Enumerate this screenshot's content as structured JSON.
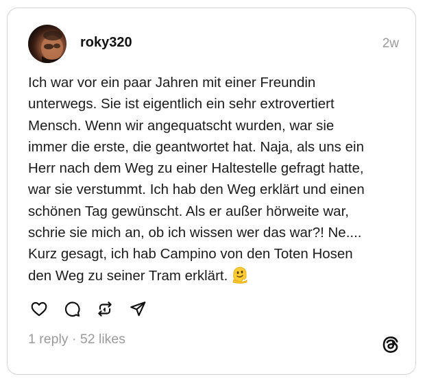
{
  "post": {
    "username": "roky320",
    "time": "2w",
    "text_lines": [
      "Ich war vor ein paar Jahren mit einer Freundin",
      "unterwegs. Sie ist eigentlich ein sehr extrovertiert",
      "Mensch. Wenn wir angequatscht wurden, war sie",
      "immer die erste, die geantwortet hat. Naja, als uns ein",
      "Herr nach dem Weg zu einer Haltestelle gefragt hatte,",
      "war sie verstummt. Ich hab den Weg erklärt und einen",
      "schönen Tag gewünscht. Als er außer hörweite war,",
      "schrie sie mich an, ob ich wissen wer das war?! Ne....",
      "Kurz gesagt, ich hab Campino von den Toten Hosen",
      "den Weg zu seiner Tram erklärt."
    ],
    "emoji": "melting-face-emoji",
    "actions": [
      "heart-icon",
      "comment-icon",
      "repost-icon",
      "share-icon"
    ],
    "stats": {
      "replies": "1 reply",
      "separator": " · ",
      "likes": "52 likes"
    },
    "logo": "threads-logo-icon"
  },
  "colors": {
    "text": "#1b1b1b",
    "muted": "#9a9a9a",
    "border": "#d4d4d4"
  }
}
